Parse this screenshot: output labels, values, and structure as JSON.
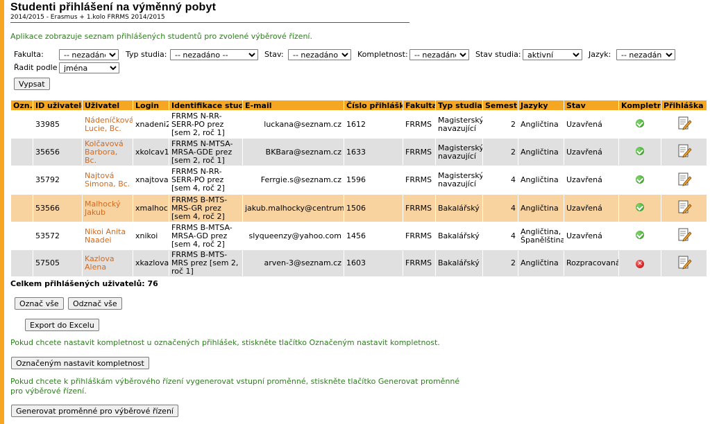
{
  "page": {
    "title": "Studenti přihlášení na výměnný pobyt",
    "subtitle": "2014/2015 - Erasmus + 1.kolo FRRMS 2014/2015",
    "intro": "Aplikace zobrazuje seznam přihlášených studentů pro zvolené výběrové řízení."
  },
  "filters": {
    "fakulta": {
      "label": "Fakulta:",
      "value": "-- nezadáno --"
    },
    "typ_studia": {
      "label": "Typ studia:",
      "value": "-- nezadáno --"
    },
    "stav": {
      "label": "Stav:",
      "value": "-- nezadáno --"
    },
    "kompletnost": {
      "label": "Kompletnost:",
      "value": "-- nezadáno --"
    },
    "stav_studia": {
      "label": "Stav studia:",
      "value": "aktivní"
    },
    "jazyk": {
      "label": "Jazyk:",
      "value": "-- nezadáno --"
    },
    "radit_podle": {
      "label": "Řadit podle",
      "value": "jména"
    },
    "submit_label": "Vypsat"
  },
  "table": {
    "headers": [
      "Ozn.",
      "ID uživatele",
      "Uživatel",
      "Login",
      "Identifikace studia",
      "E-mail",
      "Číslo přihlášky",
      "Fakulta",
      "Typ studia",
      "Semestr",
      "Jazyky",
      "Stav",
      "Kompletní",
      "Přihláška"
    ],
    "rows": [
      {
        "id": "33985",
        "user": "Nádeníčková Lucie, Bc.",
        "login": "xnadeni2",
        "study": "FRRMS N-RR-SERR-PO prez [sem 2, roč 1]",
        "email": "luckana@seznam.cz",
        "app": "1612",
        "faculty": "FRRMS",
        "type": "Magisterský navazující",
        "semester": "2",
        "langs": "Angličtina",
        "state": "Uzavřená",
        "complete": "ok-icon",
        "style": "r-white"
      },
      {
        "id": "35656",
        "user": "Kolčavová Barbora, Bc.",
        "login": "xkolcav1",
        "study": "FRRMS N-MTSA-MRSA-GDE prez [sem 2, roč 1]",
        "email": "BKBara@seznam.cz",
        "app": "1633",
        "faculty": "FRRMS",
        "type": "Magisterský navazující",
        "semester": "2",
        "langs": "Angličtina",
        "state": "Uzavřená",
        "complete": "ok-icon",
        "style": "r-grey"
      },
      {
        "id": "35792",
        "user": "Najtová Simona, Bc.",
        "login": "xnajtova",
        "study": "FRRMS N-RR-SERR-PO prez [sem 4, roč 2]",
        "email": "Ferrgie.s@seznam.cz",
        "app": "1596",
        "faculty": "FRRMS",
        "type": "Magisterský navazující",
        "semester": "4",
        "langs": "Angličtina",
        "state": "Uzavřená",
        "complete": "ok-icon",
        "style": "r-white"
      },
      {
        "id": "53566",
        "user": "Malhocký Jakub",
        "login": "xmalhoc1",
        "study": "FRRMS B-MTS-MRS-GR prez [sem 4, roč 2]",
        "email": "jakub.malhocky@centrum.cz",
        "app": "1506",
        "faculty": "FRRMS",
        "type": "Bakalářský",
        "semester": "4",
        "langs": "Angličtina",
        "state": "Uzavřená",
        "complete": "ok-icon",
        "style": "r-hl"
      },
      {
        "id": "53572",
        "user": "Nikoi Anita Naadei",
        "login": "xnikoi",
        "study": "FRRMS B-MTSA-MRSA-GD prez [sem 4, roč 2]",
        "email": "slyqueenzy@yahoo.com",
        "app": "1456",
        "faculty": "FRRMS",
        "type": "Bakalářský",
        "semester": "4",
        "langs": "Angličtina, Španělština",
        "state": "Uzavřená",
        "complete": "ok-icon",
        "style": "r-white"
      },
      {
        "id": "57505",
        "user": "Kazlova Alena",
        "login": "xkazlova",
        "study": "FRRMS B-MTS-MRS prez [sem 2, roč 1]",
        "email": "arven-3@seznam.cz",
        "app": "1603",
        "faculty": "FRRMS",
        "type": "Bakalářský",
        "semester": "2",
        "langs": "Angličtina",
        "state": "Rozpracovaná",
        "complete": "err-icon",
        "style": "r-grey"
      }
    ]
  },
  "summary": {
    "total_label": "Celkem přihlášených uživatelů: 76"
  },
  "actions": {
    "select_all": "Označ vše",
    "deselect_all": "Odznač vše",
    "export": "Export do Excelu",
    "completeness_msg": "Pokud chcete nastavit kompletnost u označených přihlášek, stiskněte tlačítko Označeným nastavit kompletnost.",
    "completeness_btn": "Označeným nastavit kompletnost",
    "generate_msg": "Pokud chcete k přihláškám výběrového řízení vygenerovat vstupní proměnné, stiskněte tlačítko Generovat proměnné pro výběrové řízení.",
    "generate_btn": "Generovat proměnné pro výběrové řízení"
  },
  "colors": {
    "accent": "#f5a623",
    "green_text": "#2e7d1f",
    "user_link": "#d2691e",
    "highlight_row": "#f8d3a0",
    "grey_row": "#e0e0e0"
  }
}
